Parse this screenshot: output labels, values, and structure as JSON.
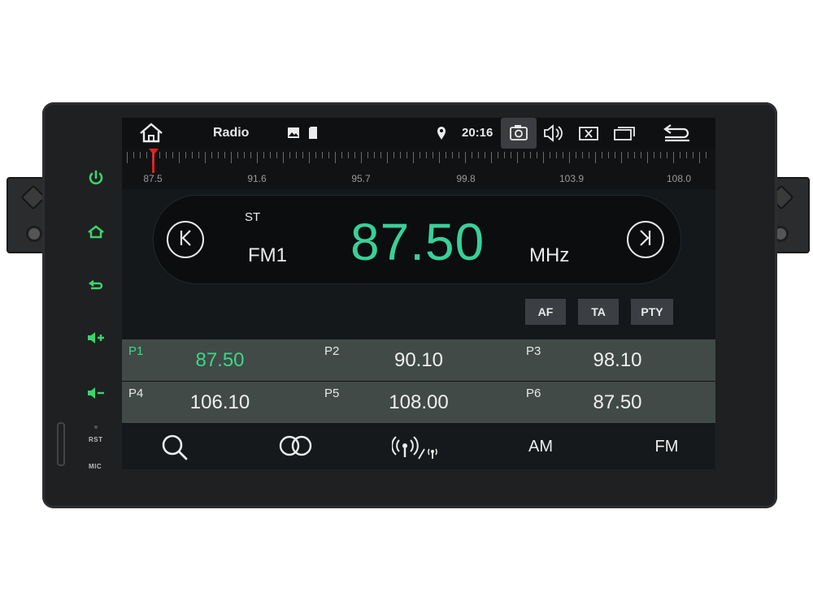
{
  "colors": {
    "accent_green": "#3bd68a",
    "needle_red": "#e02020",
    "preset_bg": "#414a46"
  },
  "statusbar": {
    "title": "Radio",
    "time": "20:16",
    "icons": [
      "home-icon",
      "image-icon",
      "sd-card-icon",
      "location-icon",
      "camera-icon",
      "volume-icon",
      "close-window-icon",
      "recent-apps-icon",
      "back-icon"
    ]
  },
  "side_controls": {
    "icons": [
      "power-icon",
      "home-icon",
      "back-icon",
      "volume-up-icon",
      "volume-down-icon"
    ],
    "rst_label": "RST",
    "mic_label": "MIC"
  },
  "dial": {
    "labels": [
      "87.5",
      "91.6",
      "95.7",
      "99.8",
      "103.9",
      "108.0"
    ],
    "range": [
      87.5,
      108.0
    ],
    "current": 87.5
  },
  "tuner": {
    "stereo": "ST",
    "band": "FM1",
    "frequency": "87.50",
    "unit": "MHz"
  },
  "options": {
    "af": "AF",
    "ta": "TA",
    "pty": "PTY"
  },
  "presets": [
    {
      "tag": "P1",
      "freq": "87.50",
      "active": true
    },
    {
      "tag": "P2",
      "freq": "90.10",
      "active": false
    },
    {
      "tag": "P3",
      "freq": "98.10",
      "active": false
    },
    {
      "tag": "P4",
      "freq": "106.10",
      "active": false
    },
    {
      "tag": "P5",
      "freq": "108.00",
      "active": false
    },
    {
      "tag": "P6",
      "freq": "87.50",
      "active": false
    }
  ],
  "bottombar": {
    "icons": [
      "search-icon",
      "stereo-icon",
      "local-distance-icon"
    ],
    "am": "AM",
    "fm": "FM"
  }
}
